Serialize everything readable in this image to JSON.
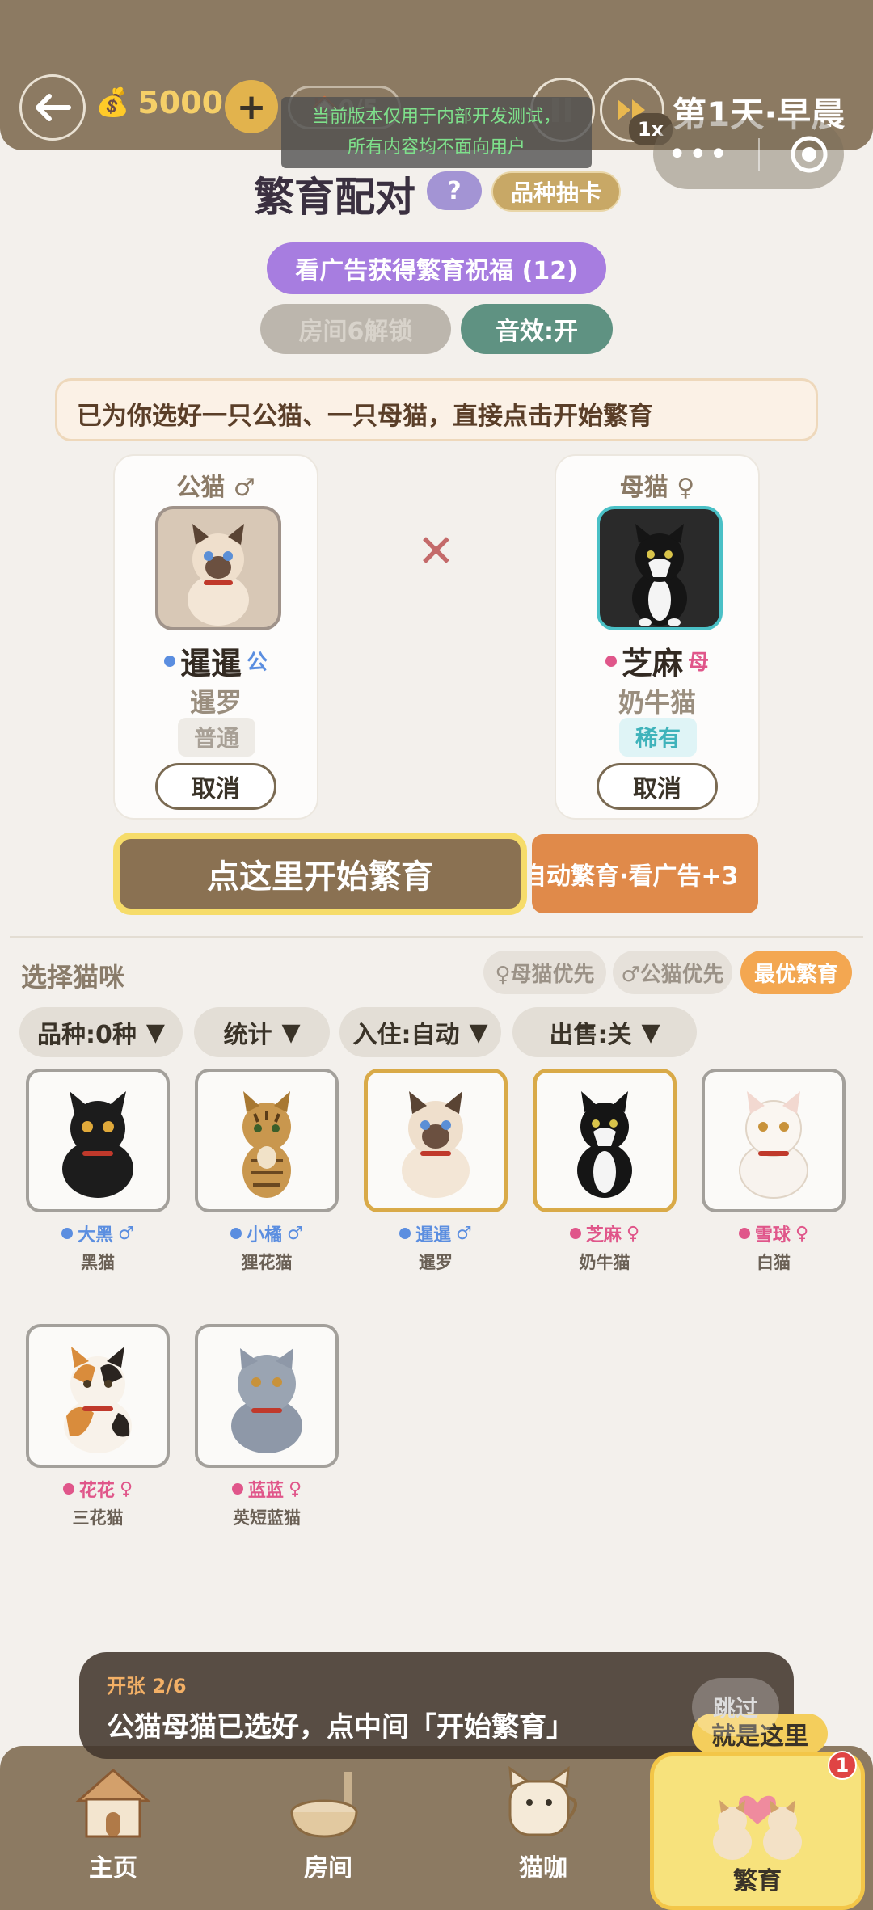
{
  "header": {
    "coins": "5000",
    "room_count": "🏠0/5",
    "speed": "1x",
    "day_label": "第1天·早晨",
    "dev_notice_line1": "当前版本仅用于内部开发测试，",
    "dev_notice_line2": "所有内容均不面向用户"
  },
  "title": {
    "text": "繁育配对",
    "help": "?",
    "gacha": "品种抽卡"
  },
  "actions": {
    "ad_bless": "看广告获得繁育祝福 (12)",
    "unlock_room": "房间6解锁",
    "sound": "音效:开"
  },
  "hint": "已为你选好一只公猫、一只母猫，直接点击开始繁育",
  "male_card": {
    "label": "公猫 ♂",
    "name": "暹暹",
    "tag": "公",
    "breed": "暹罗",
    "rarity": "普通",
    "cancel": "取消"
  },
  "female_card": {
    "label": "母猫 ♀",
    "name": "芝麻",
    "tag": "母",
    "breed": "奶牛猫",
    "rarity": "稀有",
    "cancel": "取消"
  },
  "cross": "✕",
  "start_button": "点这里开始繁育",
  "auto_button": "自动繁育·看广告+3",
  "select": {
    "title": "选择猫咪",
    "female_first": "♀母猫优先",
    "male_first": "♂公猫优先",
    "best": "最优繁育"
  },
  "dropdowns": {
    "breed": "品种:0种",
    "stats": "统计",
    "checkin": "入住:自动",
    "sale": "出售:关",
    "arrow": "▼"
  },
  "cats": [
    {
      "name": "大黑",
      "sex": "♂",
      "breed": "黑猫"
    },
    {
      "name": "小橘",
      "sex": "♂",
      "breed": "狸花猫"
    },
    {
      "name": "暹暹",
      "sex": "♂",
      "breed": "暹罗"
    },
    {
      "name": "芝麻",
      "sex": "♀",
      "breed": "奶牛猫"
    },
    {
      "name": "雪球",
      "sex": "♀",
      "breed": "白猫"
    },
    {
      "name": "花花",
      "sex": "♀",
      "breed": "三花猫"
    },
    {
      "name": "蓝蓝",
      "sex": "♀",
      "breed": "英短蓝猫"
    }
  ],
  "tutorial": {
    "step": "开张 2/6",
    "message": "公猫母猫已选好，点中间「开始繁育」",
    "skip": "跳过",
    "here": "就是这里"
  },
  "nav": {
    "home": "主页",
    "room": "房间",
    "cafe": "猫咖",
    "breed": "繁育",
    "badge": "1"
  },
  "colors": {
    "male_dot": "#5b8ee0",
    "female_dot": "#e0568a",
    "accent_brown": "#8c7a62",
    "highlight_yellow": "#f6dc6a"
  }
}
